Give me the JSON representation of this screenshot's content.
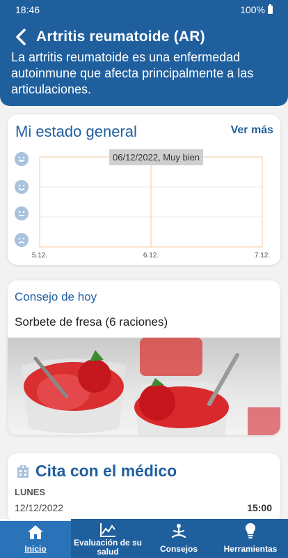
{
  "status_bar": {
    "time": "18:46",
    "battery": "100%"
  },
  "header": {
    "title": "Artritis reumatoide (AR)",
    "description": "La artritis reumatoide es una enfermedad autoinmune que afecta principalmente a las articulaciones."
  },
  "status_card": {
    "title": "Mi estado general",
    "see_more": "Ver más",
    "tooltip": "06/12/2022, Muy bien",
    "faces": [
      "very-happy-face-icon",
      "happy-face-icon",
      "neutral-face-icon",
      "sad-face-icon"
    ],
    "chart_data": {
      "type": "line",
      "x_ticks": [
        "5.12.",
        "6.12.",
        "7.12."
      ],
      "y_levels": [
        "Muy bien",
        "Bien",
        "Regular",
        "Mal"
      ],
      "points": []
    }
  },
  "tip_card": {
    "title": "Consejo de hoy",
    "text": "Sorbete de fresa (6 raciones)"
  },
  "appointment_card": {
    "title": "Cita con el médico",
    "day": "LUNES",
    "date": "12/12/2022",
    "time": "15:00"
  },
  "bottom_nav": {
    "items": [
      {
        "label": "Inicio",
        "icon": "home-icon"
      },
      {
        "label": "Evaluación de su salud",
        "icon": "chart-icon"
      },
      {
        "label": "Consejos",
        "icon": "meditation-icon"
      },
      {
        "label": "Herramientas",
        "icon": "lightbulb-icon"
      }
    ]
  },
  "colors": {
    "primary": "#1f5f9e",
    "accent_grid": "#f5c9a0",
    "tab_active": "#2a73b8"
  }
}
